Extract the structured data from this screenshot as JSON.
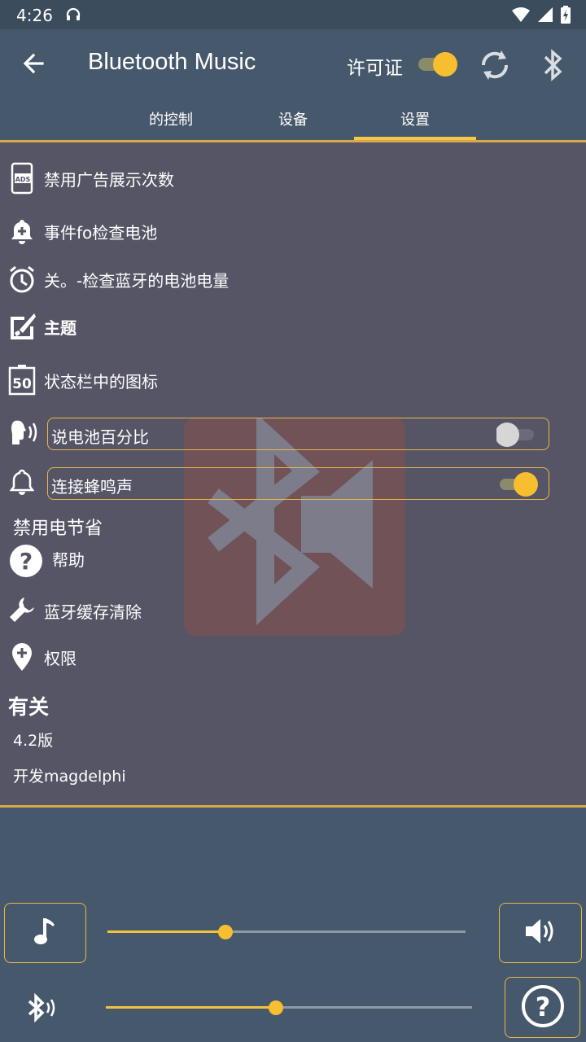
{
  "status": {
    "time": "4:26"
  },
  "appbar": {
    "title": "Bluetooth Music",
    "license_label": "许可证",
    "license_on": true
  },
  "tabs": [
    {
      "label": "的控制",
      "active": false
    },
    {
      "label": "设备",
      "active": false
    },
    {
      "label": "设置",
      "active": true
    }
  ],
  "settings": {
    "disable_ads": "禁用广告展示次数",
    "event_battery": "事件fo检查电池",
    "alarm_battery": "关。-检查蓝牙的电池电量",
    "theme": "主题",
    "statusbar_icon": "状态栏中的图标",
    "speak_battery": {
      "label": "说电池百分比",
      "on": false
    },
    "connect_beep": {
      "label": "连接蜂鸣声",
      "on": true
    },
    "disable_power_save": "禁用电节省",
    "help": "帮助",
    "clear_cache": "蓝牙缓存清除",
    "permissions": "权限"
  },
  "about": {
    "heading": "有关",
    "version": "4.2版",
    "developer": "开发magdelphi"
  },
  "controls": {
    "music_volume": 0.33,
    "bt_volume": 0.465
  },
  "colors": {
    "accent": "#f7be2f",
    "panel": "#555566",
    "bar": "#46586b",
    "border": "#d8a84a"
  }
}
